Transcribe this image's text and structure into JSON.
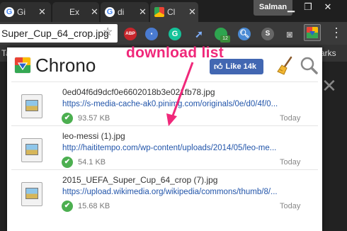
{
  "browser": {
    "tabs": [
      {
        "label": "Gi",
        "favicon": "google-icon"
      },
      {
        "label": "Ex",
        "favicon": "blank-page-icon"
      },
      {
        "label": "di",
        "favicon": "google-icon"
      },
      {
        "label": "Cl",
        "favicon": "chrome-webstore-icon"
      }
    ],
    "tab_close": "✕",
    "profile_name": "Salman",
    "omnibox_text": "Super_Cup_64_crop.jpg",
    "extensions": [
      {
        "name": "adblock-plus-icon",
        "label": "ABP",
        "color": "#c7252b"
      },
      {
        "name": "green-extension-icon",
        "badge": "12",
        "color": "#2ea44f"
      },
      {
        "name": "s-extension-icon",
        "label": "S",
        "color": "#666666"
      }
    ],
    "bookmarks_left": "Ta",
    "bookmarks_right": "arks"
  },
  "popup": {
    "title": "Chrono",
    "like_label": "Like 14k",
    "downloads": [
      {
        "filename": "0ed04f6d9dcf0e6602018b3e021fb78.jpg",
        "url": "https://s-media-cache-ak0.pinimg.com/originals/0e/d0/4f/0...",
        "size": "93.57 KB",
        "date": "Today"
      },
      {
        "filename": "leo-messi (1).jpg",
        "url": "http://haititempo.com/wp-content/uploads/2014/05/leo-me...",
        "size": "54.1 KB",
        "date": "Today"
      },
      {
        "filename": "2015_UEFA_Super_Cup_64_crop (7).jpg",
        "url": "https://upload.wikimedia.org/wikipedia/commons/thumb/8/...",
        "size": "15.68 KB",
        "date": "Today"
      }
    ]
  },
  "annotation": {
    "text": "download list",
    "color": "#f0287a"
  }
}
